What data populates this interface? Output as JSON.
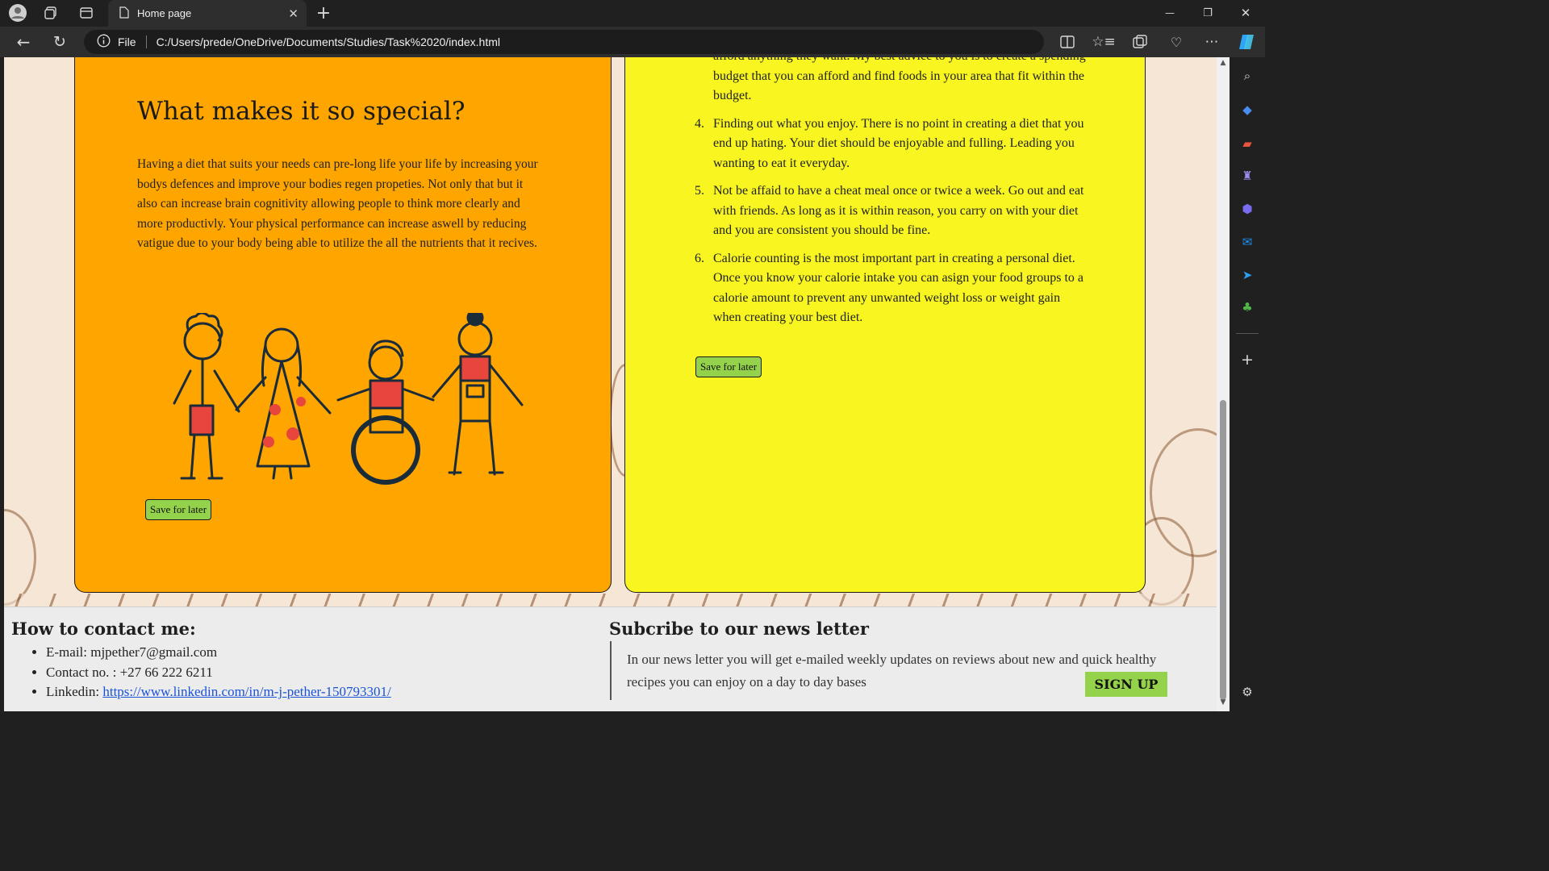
{
  "browser": {
    "tab_title": "Home page",
    "tab_close": "✕",
    "new_tab": "+",
    "address_prefix": "File",
    "address_url": "C:/Users/prede/OneDrive/Documents/Studies/Task%2020/index.html",
    "window_controls": {
      "minimize": "—",
      "restore": "❐",
      "close": "✕"
    }
  },
  "special": {
    "heading": "What makes it so special?",
    "body": "Having a diet that suits your needs can pre-long life your life by increasing your bodys defences and improve your bodies regen propeties. Not only that but it also can increase brain cognitivity allowing people to think more clearly and more productivly. Your physical performance can increase aswell by reducing vatigue due to your body being able to utilize the all the nutrients that it recives.",
    "save_label": "Save for later"
  },
  "tips": {
    "items": [
      {
        "num": "",
        "text": "afford anything they want. My best advice to you is to create a spending budget that you can afford and find foods in your area that fit within the budget."
      },
      {
        "num": "4.",
        "text": "Finding out what you enjoy. There is no point in creating a diet that you end up hating. Your diet should be enjoyable and fulling. Leading you wanting to eat it everyday."
      },
      {
        "num": "5.",
        "text": "Not be affaid to have a cheat meal once or twice a week. Go out and eat with friends. As long as it is within reason, you carry on with your diet and you are consistent you should be fine."
      },
      {
        "num": "6.",
        "text": "Calorie counting is the most important part in creating a personal diet. Once you know your calorie intake you can asign your food groups to a calorie amount to prevent any unwanted weight loss or weight gain when creating your best diet."
      }
    ],
    "save_label": "Save for later"
  },
  "footer": {
    "contact_heading": "How to contact me:",
    "email": "E-mail: mjpether7@gmail.com",
    "phone": "Contact no. : +27 66 222 6211",
    "linkedin_label": "Linkedin: ",
    "linkedin_url": "https://www.linkedin.com/in/m-j-pether-150793301/",
    "news_heading": "Subcribe to our news letter",
    "news_body": "In our news letter you will get e-mailed weekly updates on reviews about new and quick healthy recipes you can enjoy on a day to day bases",
    "signup_label": "SIGN UP"
  },
  "colors": {
    "card_left": "#ffa500",
    "card_right": "#f8f521",
    "button_green": "#93d24a",
    "link_blue": "#1a53d6"
  }
}
